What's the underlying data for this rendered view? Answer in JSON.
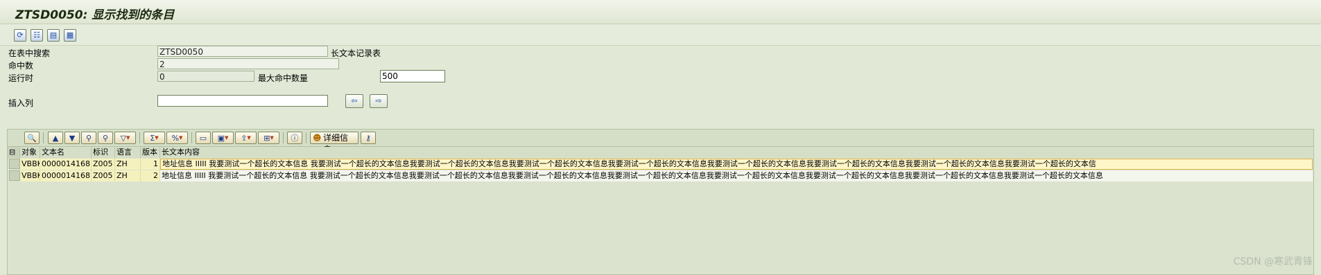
{
  "window": {
    "title": "ZTSD0050: 显示找到的条目"
  },
  "toolbar": {
    "icons": [
      "refresh-icon",
      "check-table-icon",
      "save-icon",
      "print-icon"
    ]
  },
  "form": {
    "search_table_label": "在表中搜索",
    "search_table_value": "ZTSD0050",
    "search_table_desc": "长文本记录表",
    "hits_label": "命中数",
    "hits_value": "2",
    "runtime_label": "运行时",
    "runtime_value": "0",
    "max_hits_label": "最大命中数量",
    "max_hits_value": "500",
    "insert_col_label": "插入列",
    "insert_col_value": ""
  },
  "alv": {
    "detail_button": "详细信息",
    "columns": [
      "对象",
      "文本名",
      "标识",
      "语言",
      "版本",
      "长文本内容"
    ],
    "rows": [
      {
        "object": "VBBK",
        "text_name": "0000014168",
        "id": "Z005",
        "lang": "ZH",
        "version": "1",
        "content": "地址信息 IIIII 我要测试一个超长的文本信息 我要测试一个超长的文本信息我要测试一个超长的文本信息我要测试一个超长的文本信息我要测试一个超长的文本信息我要测试一个超长的文本信息我要测试一个超长的文本信息我要测试一个超长的文本信息我要测试一个超长的文本信"
      },
      {
        "object": "VBBK",
        "text_name": "0000014168",
        "id": "Z005",
        "lang": "ZH",
        "version": "2",
        "content": "地址信息 IIIII 我要测试一个超长的文本信息 我要测试一个超长的文本信息我要测试一个超长的文本信息我要测试一个超长的文本信息我要测试一个超长的文本信息我要测试一个超长的文本信息我要测试一个超长的文本信息我要测试一个超长的文本信息我要测试一个超长的文本信息"
      }
    ]
  },
  "watermark": "CSDN @寒武青锋"
}
